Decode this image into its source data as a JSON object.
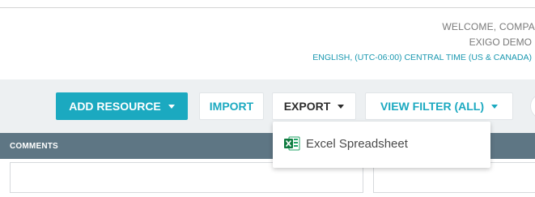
{
  "header": {
    "welcome": "WELCOME, COMPA",
    "tenant": "EXIGO DEMO",
    "locale": "ENGLISH, (UTC-06:00) CENTRAL TIME (US & CANADA)"
  },
  "toolbar": {
    "add_resource_label": "ADD RESOURCE",
    "import_label": "IMPORT",
    "export_label": "EXPORT",
    "view_filter_label": "VIEW FILTER (ALL)"
  },
  "export_menu": {
    "items": [
      {
        "label": "Excel Spreadsheet",
        "icon": "excel-icon"
      }
    ]
  },
  "table": {
    "columns": [
      "COMMENTS"
    ]
  },
  "colors": {
    "accent": "#1ba9c0",
    "header_bar": "#5e7684",
    "toolbar_bg": "#edf0f2"
  }
}
